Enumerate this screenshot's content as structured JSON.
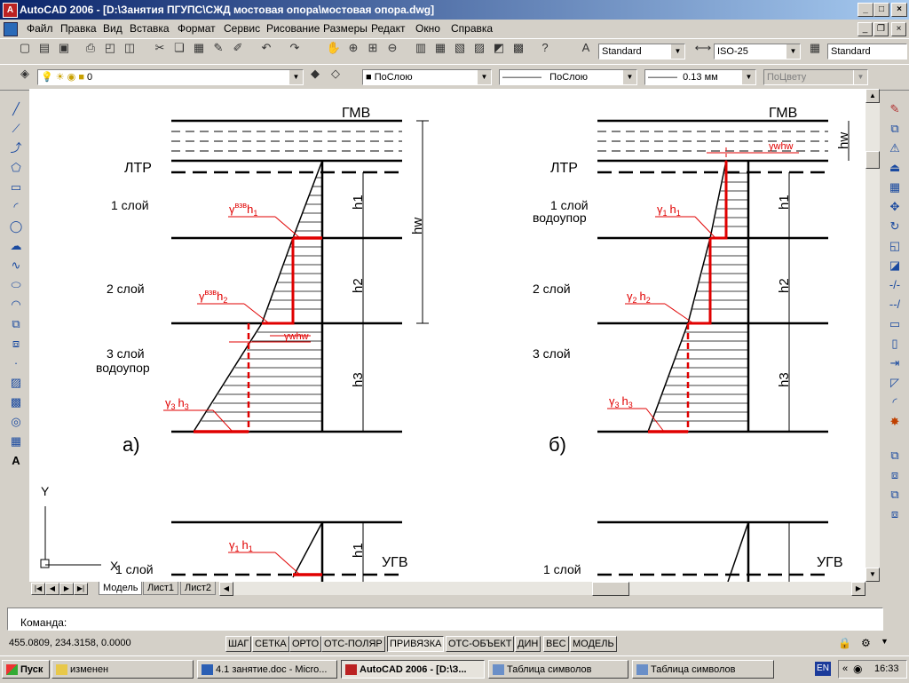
{
  "window": {
    "title": "AutoCAD 2006 - [D:\\Занятия ПГУПС\\СЖД мостовая опора\\мостовая опора.dwg]"
  },
  "menu": [
    "Файл",
    "Правка",
    "Вид",
    "Вставка",
    "Формат",
    "Сервис",
    "Рисование",
    "Размеры",
    "Редакт",
    "Окно",
    "Справка"
  ],
  "toolbar": {
    "text_style": "Standard",
    "dim_style": "ISO-25",
    "table_style": "Standard",
    "layer": "0",
    "color": "ПоСлою",
    "linetype": "ПоСлою",
    "lineweight": "0.13 мм",
    "plot_style": "ПоЦвету"
  },
  "drawing": {
    "labels": {
      "gmv": "ГМВ",
      "ltr": "ЛТР",
      "ugv": "УГВ",
      "layer1": "1 слой",
      "layer2": "2 слой",
      "layer3": "3 слой",
      "aquitard": "водоупор",
      "h1": "h1",
      "h2": "h2",
      "h3": "h3",
      "hw": "hw",
      "fig_a": "а)",
      "fig_b": "б)",
      "gamma": "γ",
      "h": "h",
      "sub1": "1",
      "sub2": "2",
      "sub3": "3",
      "vzv": "взв",
      "gwhw": "γwhw",
      "ucs_y": "Y",
      "ucs_x": "X"
    }
  },
  "tabs": [
    "Модель",
    "Лист1",
    "Лист2"
  ],
  "command": {
    "prompt": "Команда:"
  },
  "status": {
    "coords": "455.0809, 234.3158, 0.0000",
    "buttons": [
      {
        "label": "ШАГ",
        "on": false
      },
      {
        "label": "СЕТКА",
        "on": false
      },
      {
        "label": "ОРТО",
        "on": false
      },
      {
        "label": "ОТС-ПОЛЯР",
        "on": false
      },
      {
        "label": "ПРИВЯЗКА",
        "on": true
      },
      {
        "label": "ОТС-ОБЪЕКТ",
        "on": false
      },
      {
        "label": "ДИН",
        "on": false
      },
      {
        "label": "ВЕС",
        "on": false
      },
      {
        "label": "МОДЕЛЬ",
        "on": false
      }
    ]
  },
  "taskbar": {
    "start": "Пуск",
    "items": [
      {
        "label": "изменен",
        "active": false
      },
      {
        "label": "4.1 занятие.doc - Micro...",
        "active": false
      },
      {
        "label": "AutoCAD 2006 - [D:\\З...",
        "active": true
      },
      {
        "label": "Таблица символов",
        "active": false
      },
      {
        "label": "Таблица символов",
        "active": false
      }
    ],
    "lang": "EN",
    "clock": "16:33"
  }
}
